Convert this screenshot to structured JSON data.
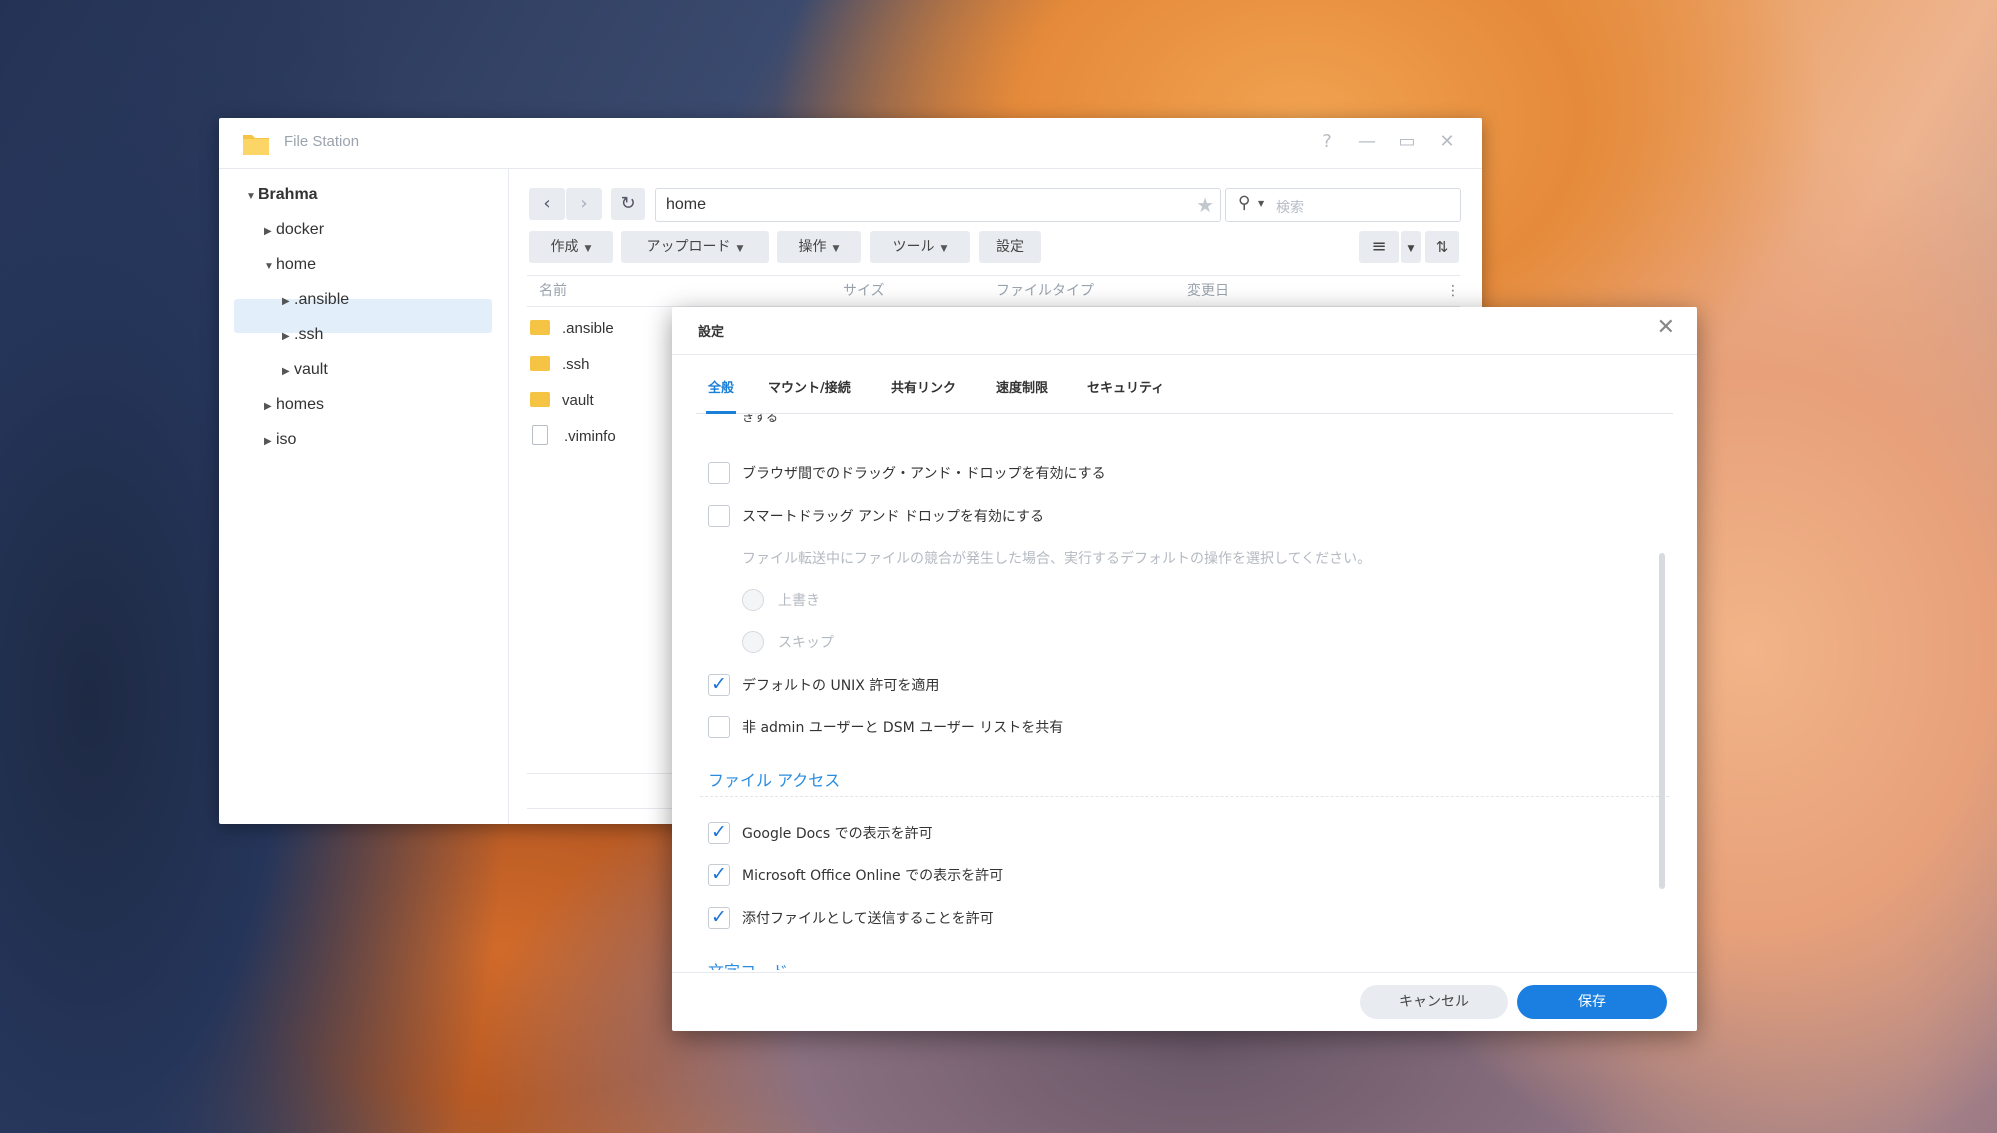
{
  "window": {
    "title": "File Station",
    "help": "?",
    "minimize": "—",
    "maximize": "▭",
    "close": "✕"
  },
  "tree": {
    "root": "Brahma",
    "items": [
      {
        "label": "docker"
      },
      {
        "label": "home"
      },
      {
        "label": ".ansible"
      },
      {
        "label": ".ssh"
      },
      {
        "label": "vault"
      },
      {
        "label": "homes"
      },
      {
        "label": "iso"
      }
    ]
  },
  "toolbar": {
    "path": "home",
    "search_placeholder": "検索",
    "create": "作成",
    "upload": "アップロード",
    "action": "操作",
    "tools": "ツール",
    "settings": "設定"
  },
  "columns": [
    "名前",
    "サイズ",
    "ファイルタイプ",
    "変更日"
  ],
  "files": [
    {
      "name": ".ansible",
      "type": "folder"
    },
    {
      "name": ".ssh",
      "type": "folder"
    },
    {
      "name": "vault",
      "type": "folder"
    },
    {
      "name": ".viminfo",
      "type": "file"
    }
  ],
  "dialog": {
    "title": "設定",
    "tabs": [
      "全般",
      "マウント/接続",
      "共有リンク",
      "速度制限",
      "セキュリティ"
    ],
    "cut_text": "きする",
    "options": [
      {
        "label": "ブラウザ間でのドラッグ・アンド・ドロップを有効にする",
        "checked": false
      },
      {
        "label": "スマートドラッグ アンド ドロップを有効にする",
        "checked": false
      }
    ],
    "conflict_hint": "ファイル転送中にファイルの競合が発生した場合、実行するデフォルトの操作を選択してください。",
    "radio_overwrite": "上書き",
    "radio_skip": "スキップ",
    "unix_perm": "デフォルトの UNIX 許可を適用",
    "share_users": "非 admin ユーザーと DSM ユーザー リストを共有",
    "section_file_access": "ファイル アクセス",
    "access_options": [
      {
        "label": "Google Docs での表示を許可",
        "checked": true
      },
      {
        "label": "Microsoft Office Online での表示を許可",
        "checked": true
      },
      {
        "label": "添付ファイルとして送信することを許可",
        "checked": true
      }
    ],
    "section_charset": "文字コード",
    "cancel": "キャンセル",
    "save": "保存"
  }
}
